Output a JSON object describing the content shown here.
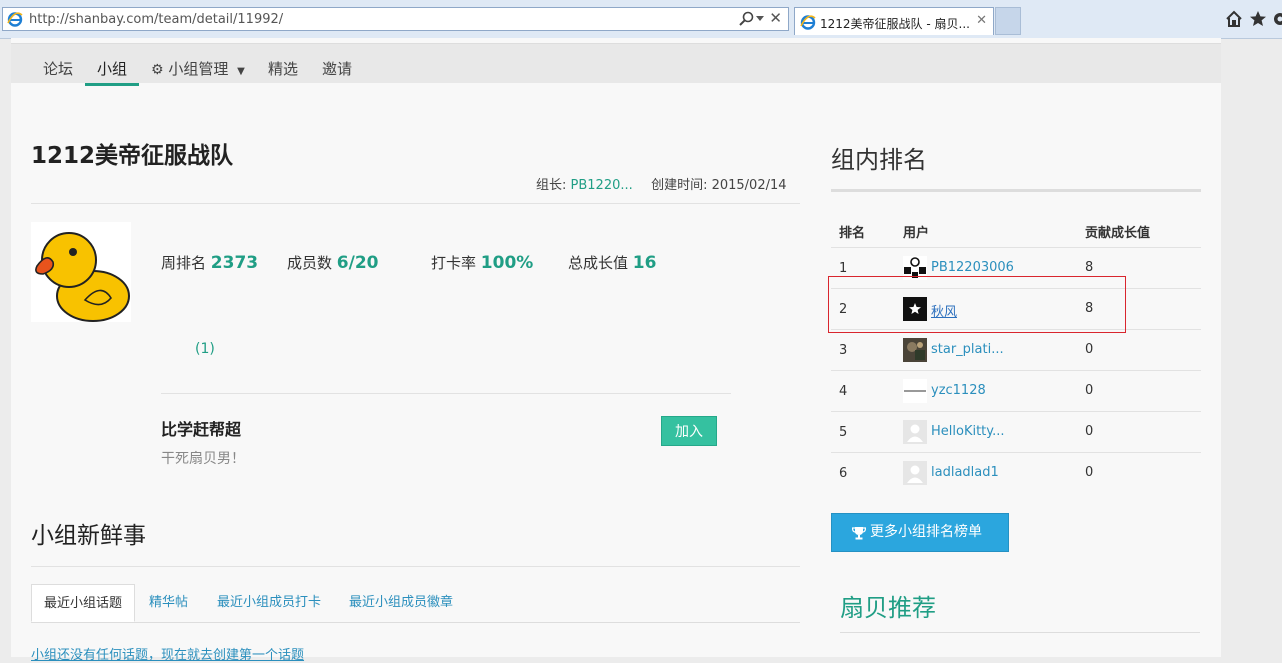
{
  "browser": {
    "url": "http://shanbay.com/team/detail/11992/",
    "tab_title": "1212美帝征服战队 - 扇贝..."
  },
  "nav": {
    "items": [
      "论坛",
      "小组",
      "小组管理",
      "精选",
      "邀请"
    ],
    "active": "小组"
  },
  "team": {
    "name": "1212美帝征服战队",
    "leader_label": "组长:",
    "leader": "PB1220...",
    "created_label": "创建时间:",
    "created": "2015/02/14",
    "stats": {
      "weekly_rank_label": "周排名",
      "weekly_rank": "2373",
      "members_label": "成员数",
      "members": "6/20",
      "checkin_label": "打卡率",
      "checkin": "100%",
      "growth_label": "总成长值",
      "growth": "16"
    },
    "badge_count": "(1)",
    "slogan_title": "比学赶帮超",
    "slogan_sub": "干死扇贝男！",
    "join_label": "加入"
  },
  "news": {
    "title": "小组新鲜事",
    "tabs": [
      "最近小组话题",
      "精华帖",
      "最近小组成员打卡",
      "最近小组成员徽章"
    ],
    "empty_message": "小组还没有任何话题，现在就去创建第一个话题"
  },
  "ranking": {
    "title": "组内排名",
    "headers": [
      "排名",
      "用户",
      "贡献成长值"
    ],
    "rows": [
      {
        "rank": "1",
        "user": "PB12203006",
        "score": "8",
        "avatar": "panda-avatar"
      },
      {
        "rank": "2",
        "user": "秋风",
        "score": "8",
        "avatar": "dark-star-avatar"
      },
      {
        "rank": "3",
        "user": "star_plati...",
        "score": "0",
        "avatar": "photo-avatar"
      },
      {
        "rank": "4",
        "user": "yzc1128",
        "score": "0",
        "avatar": "text-avatar"
      },
      {
        "rank": "5",
        "user": "HelloKitty...",
        "score": "0",
        "avatar": "default-avatar"
      },
      {
        "rank": "6",
        "user": "ladladlad1",
        "score": "0",
        "avatar": "default-avatar"
      }
    ],
    "highlighted_rank": "2",
    "more_label": "更多小组排名榜单"
  },
  "recommend": {
    "title": "扇贝推荐"
  },
  "colors": {
    "accent_green": "#209e85",
    "link_blue": "#2b8fbd",
    "button_blue": "#2ba6de",
    "join_green": "#35c1a0",
    "highlight_red": "#d9262e"
  }
}
